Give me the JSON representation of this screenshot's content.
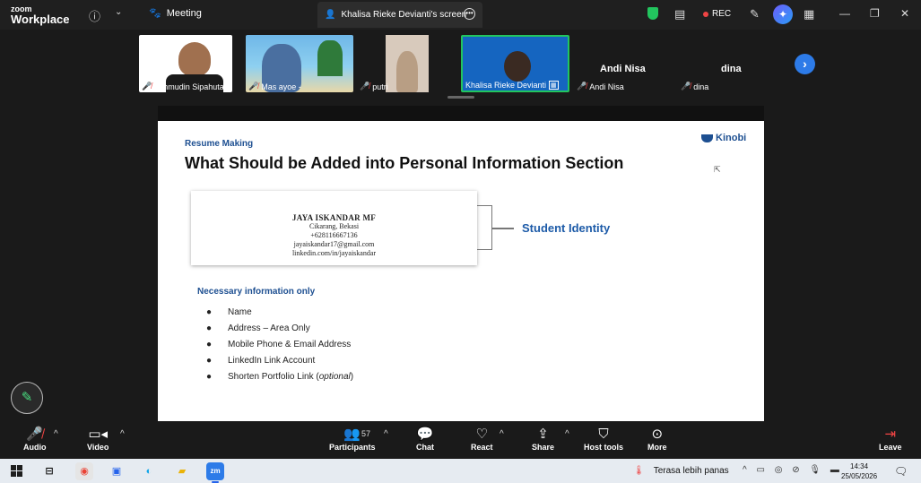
{
  "app": {
    "logo_line1": "zoom",
    "logo_line2": "Workplace",
    "info_icon": "info-icon",
    "meeting_label": "Meeting",
    "screen_tab_label": "Khalisa Rieke Devianti's screen",
    "rec_label": "REC"
  },
  "participants": [
    {
      "name": "Lahmudin Sipahutar ."
    },
    {
      "name": "Mas ayoe -"
    },
    {
      "name": "putri"
    },
    {
      "name": "Khalisa Rieke Devianti"
    },
    {
      "name": "Andi Nisa",
      "label": "Andi Nisa"
    },
    {
      "name": "dina",
      "label": "dina"
    }
  ],
  "slide": {
    "subtitle": "Resume Making",
    "title": "What Should be Added into Personal Information Section",
    "brand": "Kinobi",
    "resume": {
      "name": "JAYA ISKANDAR MF",
      "lines": [
        "Cikarang, Bekasi",
        "+628116667136",
        "jayaiskandar17@gmail.com",
        "linkedin.com/in/jayaiskandar"
      ]
    },
    "identity_label": "Student Identity",
    "section_heading": "Necessary information only",
    "bullets": [
      "Name",
      "Address – Area Only",
      "Mobile Phone & Email Address",
      "LinkedIn Link Account",
      "Shorten Portfolio Link ("
    ],
    "bullet_optional": "optional",
    "bullet_optional_close": ")"
  },
  "toolbar": {
    "audio": "Audio",
    "video": "Video",
    "participants": "Participants",
    "participant_count": "57",
    "chat": "Chat",
    "react": "React",
    "share": "Share",
    "host_tools": "Host tools",
    "more": "More",
    "leave": "Leave"
  },
  "taskbar": {
    "zoom_label": "zm",
    "weather": "Terasa lebih panas",
    "time": "14:34",
    "date": "25/05/2026"
  },
  "colors": {
    "accent": "#2d7be8",
    "brand_blue": "#1d4f91",
    "mic_off": "#ef4444",
    "shield": "#22c55e"
  }
}
